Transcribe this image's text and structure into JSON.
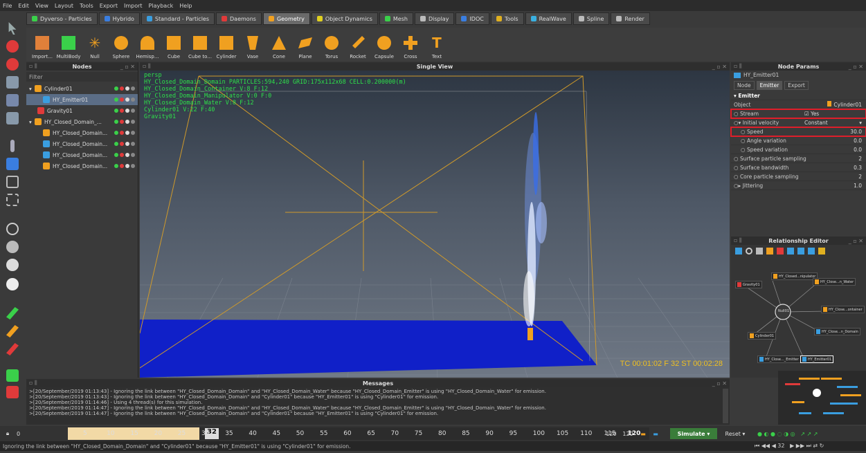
{
  "menu": [
    "File",
    "Edit",
    "View",
    "Layout",
    "Tools",
    "Export",
    "Import",
    "Playback",
    "Help"
  ],
  "tabs": [
    {
      "label": "Dyverso - Particles",
      "color": "#3ad04a"
    },
    {
      "label": "Hybrido",
      "color": "#3a7ee0"
    },
    {
      "label": "Standard - Particles",
      "color": "#3a9ee0"
    },
    {
      "label": "Daemons",
      "color": "#e03a3a"
    },
    {
      "label": "Geometry",
      "color": "#f0a020",
      "active": true
    },
    {
      "label": "Object Dynamics",
      "color": "#e0d020"
    },
    {
      "label": "Mesh",
      "color": "#3ad04a"
    },
    {
      "label": "Display",
      "color": "#bbbbbb"
    },
    {
      "label": "IDOC",
      "color": "#3a7ee0"
    },
    {
      "label": "Tools",
      "color": "#e0b020"
    },
    {
      "label": "RealWave",
      "color": "#3ab0e0"
    },
    {
      "label": "Spline",
      "color": "#bbbbbb"
    },
    {
      "label": "Render",
      "color": "#bbbbbb"
    }
  ],
  "shelf": [
    {
      "label": "Import...",
      "icon": "import-icon",
      "color": "#e0803a"
    },
    {
      "label": "MultiBody",
      "icon": "multibody-icon",
      "color": "#3ad04a"
    },
    {
      "label": "Null",
      "icon": "null-icon",
      "color": "#f0a020"
    },
    {
      "label": "Sphere",
      "icon": "sphere-icon",
      "color": "#f0a020"
    },
    {
      "label": "Hemisp...",
      "icon": "hemisphere-icon",
      "color": "#f0a020"
    },
    {
      "label": "Cube",
      "icon": "cube-icon",
      "color": "#f0a020"
    },
    {
      "label": "Cube to...",
      "icon": "cube-to-icon",
      "color": "#f0a020"
    },
    {
      "label": "Cylinder",
      "icon": "cylinder-icon",
      "color": "#f0a020"
    },
    {
      "label": "Vase",
      "icon": "vase-icon",
      "color": "#f0a020"
    },
    {
      "label": "Cone",
      "icon": "cone-icon",
      "color": "#f0a020"
    },
    {
      "label": "Plane",
      "icon": "plane-icon",
      "color": "#f0a020"
    },
    {
      "label": "Torus",
      "icon": "torus-icon",
      "color": "#f0a020"
    },
    {
      "label": "Rocket",
      "icon": "rocket-icon",
      "color": "#f0a020"
    },
    {
      "label": "Capsule",
      "icon": "capsule-icon",
      "color": "#f0a020"
    },
    {
      "label": "Cross",
      "icon": "cross-icon",
      "color": "#f0a020"
    },
    {
      "label": "Text",
      "icon": "text-icon",
      "color": "#f0a020"
    }
  ],
  "nodes_panel": {
    "title": "Nodes",
    "filter": "Filter",
    "items": [
      {
        "label": "Cylinder01",
        "color": "#f0a020"
      },
      {
        "label": "HY_Emitter01",
        "color": "#3a9ee0",
        "selected": true
      },
      {
        "label": "Gravity01",
        "color": "#e03a3a"
      },
      {
        "label": "HY_Closed_Domain_...",
        "color": "#f0a020"
      },
      {
        "label": "HY_Closed_Domain...",
        "color": "#f0a020"
      },
      {
        "label": "HY_Closed_Domain...",
        "color": "#3a9ee0"
      },
      {
        "label": "HY_Closed_Domain...",
        "color": "#3a9ee0"
      },
      {
        "label": "HY_Closed_Domain...",
        "color": "#f0a020"
      }
    ]
  },
  "viewport": {
    "title": "Single View",
    "stats": [
      "persp",
      "HY_Closed_Domain_Domain PARTICLES:594,240 GRID:175x112x68 CELL:0.200000(m)",
      "HY_Closed_Domain_Container V:8 F:12",
      "HY_Closed_Domain_Manipulator V:0 F:0",
      "HY_Closed_Domain_Water V:8 F:12",
      "Cylinder01 V:22 F:40",
      "Gravity01"
    ],
    "timecode": "TC 00:01:02  F 32  ST 00:02:28"
  },
  "node_params": {
    "title": "Node Params",
    "node": "HY_Emitter01",
    "tabs": [
      "Node",
      "Emitter",
      "Export"
    ],
    "section": "Emitter",
    "rows": [
      {
        "label": "Object",
        "value": "Cylinder01"
      },
      {
        "label": "Stream",
        "value": "Yes"
      },
      {
        "label": "Initial velocity",
        "value": "Constant"
      },
      {
        "label": "Speed",
        "value": "30.0"
      },
      {
        "label": "Angle variation",
        "value": "0.0"
      },
      {
        "label": "Speed variation",
        "value": "0.0"
      },
      {
        "label": "Surface particle sampling",
        "value": "2"
      },
      {
        "label": "Surface bandwidth",
        "value": "0.3"
      },
      {
        "label": "Core particle sampling",
        "value": "2"
      },
      {
        "label": "Jittering",
        "value": "1.0"
      }
    ]
  },
  "relationship_editor": {
    "title": "Relationship Editor",
    "nodes": [
      "HY_Closed...nipulator",
      "HY_Close...n_Water",
      "Gravity01",
      "Null01",
      "HY_Close...ontainer",
      "HY_Close...n_Domain",
      "Cylinder01",
      "HY_Close..._Emitter",
      "HY_Emitter01"
    ]
  },
  "messages": {
    "title": "Messages",
    "lines": [
      ">[20/September/2019 01:13:43] - Ignoring the link between \"HY_Closed_Domain_Domain\" and \"HY_Closed_Domain_Water\" because \"HY_Closed_Domain_Emitter\" is using \"HY_Closed_Domain_Water\" for emission.",
      ">[20/September/2019 01:13:43] - Ignoring the link between \"HY_Closed_Domain_Domain\" and \"Cylinder01\" because \"HY_Emitter01\" is using \"Cylinder01\" for emission.",
      ">[20/September/2019 01:14:46] - Using 4 thread(s) for this simulation.",
      ">[20/September/2019 01:14:47] - Ignoring the link between \"HY_Closed_Domain_Domain\" and \"HY_Closed_Domain_Water\" because \"HY_Closed_Domain_Emitter\" is using \"HY_Closed_Domain_Water\" for emission.",
      ">[20/September/2019 01:14:47] - Ignoring the link between \"HY_Closed_Domain_Domain\" and \"Cylinder01\" because \"HY_Emitter01\" is using \"Cylinder01\" for emission."
    ]
  },
  "timeline": {
    "start": "0",
    "ticks": [
      "5",
      "10",
      "15",
      "20",
      "25",
      "30",
      "35",
      "40",
      "45",
      "50",
      "55",
      "60",
      "65",
      "70",
      "75",
      "80",
      "85",
      "90",
      "95",
      "100",
      "105",
      "110",
      "115",
      "120"
    ],
    "current_frame": "32",
    "end_a": "120",
    "end_b": "120",
    "simulate_label": "Simulate",
    "progress": "0%",
    "reset_label": "Reset",
    "frame_field": "32"
  },
  "status": "Ignoring the link between \"HY_Closed_Domain_Domain\" and \"Cylinder01\" because \"HY_Emitter01\" is using \"Cylinder01\" for emission.",
  "colors": {
    "accent": "#f0a020",
    "highlight": "#e01e2a",
    "water": "#1020c8",
    "stats_text": "#2ee04a"
  }
}
